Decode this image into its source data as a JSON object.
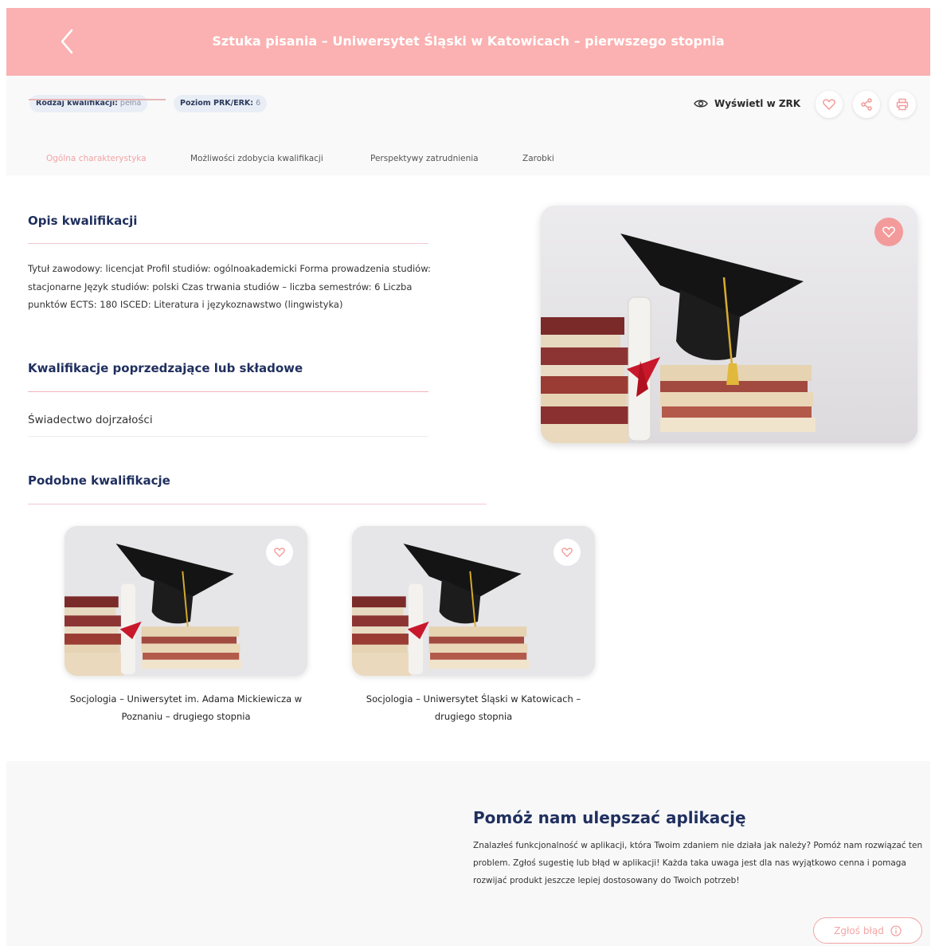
{
  "header": {
    "title": "Sztuka pisania – Uniwersytet Śląski w Katowicach – pierwszego stopnia"
  },
  "meta": {
    "kind_label": "Rodzaj kwalifikacji:",
    "kind_value": "pełna",
    "level_label": "Poziom PRK/ERK:",
    "level_value": "6",
    "zrk_label": "Wyświetl w ZRK"
  },
  "tabs": [
    {
      "label": "Ogólna charakterystyka",
      "active": true
    },
    {
      "label": "Możliwości zdobycia kwalifikacji",
      "active": false
    },
    {
      "label": "Perspektywy zatrudnienia",
      "active": false
    },
    {
      "label": "Zarobki",
      "active": false
    }
  ],
  "description": {
    "title": "Opis kwalifikacji",
    "text": "Tytuł zawodowy: licencjat Profil studiów: ogólnoakademicki Forma prowadzenia studiów: stacjonarne Język studiów: polski Czas trwania studiów – liczba semestrów: 6 Liczba punktów ECTS: 180 ISCED: Literatura i językoznawstwo (lingwistyka)"
  },
  "prerequisites": {
    "title": "Kwalifikacje poprzedzające lub składowe",
    "items": [
      "Świadectwo dojrzałości"
    ]
  },
  "similar": {
    "title": "Podobne kwalifikacje",
    "cards": [
      {
        "title": "Socjologia – Uniwersytet im. Adama Mickiewicza w Poznaniu – drugiego stopnia"
      },
      {
        "title": "Socjologia – Uniwersytet Śląski w Katowicach – drugiego stopnia"
      }
    ]
  },
  "feedback": {
    "title": "Pomóż nam ulepszać aplikację",
    "text": "Znalazłeś funkcjonalność w aplikacji, która Twoim zdaniem nie działa jak należy? Pomóż nam rozwiązać ten problem. Zgłoś sugestię lub błąd w aplikacji! Każda taka uwaga jest dla nas wyjątkowo cenna i pomaga rozwijać produkt jeszcze lepiej dostosowany do Twoich potrzeb!",
    "button_label": "Zgłoś błąd"
  },
  "icons": {
    "back": "chevron-left-icon",
    "eye": "eye-icon",
    "heart": "heart-icon",
    "share": "share-icon",
    "print": "printer-icon",
    "info": "info-icon"
  },
  "colors": {
    "header_bg": "#fbb1b1",
    "accent": "#f39b9b",
    "heading": "#1f2f5e",
    "badge_bg": "#e9eef6"
  }
}
